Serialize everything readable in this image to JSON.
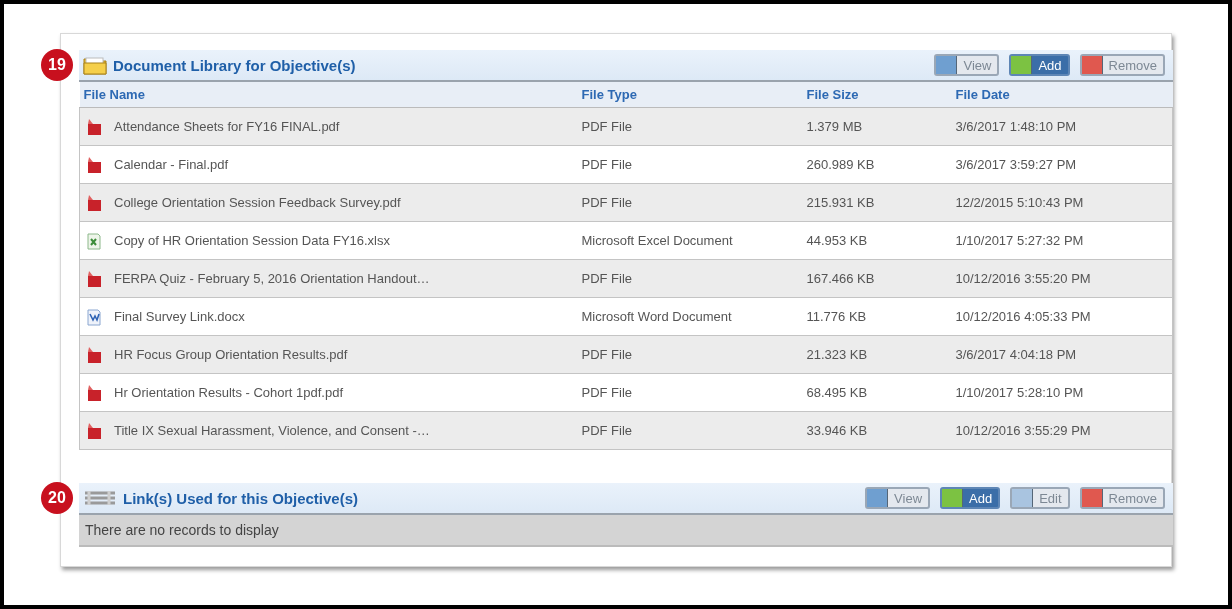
{
  "sections": [
    {
      "badge": "19",
      "kind": "documents",
      "title": "Document Library for Objective(s)",
      "buttons": [
        {
          "kind": "view",
          "label": "View",
          "disabled": true
        },
        {
          "kind": "add",
          "label": "Add",
          "disabled": false
        },
        {
          "kind": "remove",
          "label": "Remove",
          "disabled": true
        }
      ],
      "table": {
        "columns": [
          "File Name",
          "File Type",
          "File Size",
          "File Date"
        ],
        "rows": [
          {
            "kind": "pdf",
            "cells": [
              "Attendance Sheets for FY16 FINAL.pdf",
              "PDF File",
              "1.379 MB",
              "3/6/2017 1:48:10 PM"
            ]
          },
          {
            "kind": "pdf",
            "cells": [
              "Calendar - Final.pdf",
              "PDF File",
              "260.989 KB",
              "3/6/2017 3:59:27 PM"
            ]
          },
          {
            "kind": "pdf",
            "cells": [
              "College Orientation Session Feedback Survey.pdf",
              "PDF File",
              "215.931 KB",
              "12/2/2015 5:10:43 PM"
            ]
          },
          {
            "kind": "excel",
            "cells": [
              "Copy of HR Orientation Session Data FY16.xlsx",
              "Microsoft Excel Document",
              "44.953 KB",
              "1/10/2017 5:27:32 PM"
            ]
          },
          {
            "kind": "pdf",
            "cells": [
              "FERPA Quiz - February 5, 2016 Orientation Handout…",
              "PDF File",
              "167.466 KB",
              "10/12/2016 3:55:20 PM"
            ]
          },
          {
            "kind": "word",
            "cells": [
              "Final Survey Link.docx",
              "Microsoft Word Document",
              "11.776 KB",
              "10/12/2016 4:05:33 PM"
            ]
          },
          {
            "kind": "pdf",
            "cells": [
              "HR Focus Group Orientation Results.pdf",
              "PDF File",
              "21.323 KB",
              "3/6/2017 4:04:18 PM"
            ]
          },
          {
            "kind": "pdf",
            "cells": [
              "Hr Orientation Results - Cohort 1pdf.pdf",
              "PDF File",
              "68.495 KB",
              "1/10/2017 5:28:10 PM"
            ]
          },
          {
            "kind": "pdf",
            "cells": [
              "Title IX Sexual Harassment, Violence, and Consent -…",
              "PDF File",
              "33.946 KB",
              "10/12/2016 3:55:29 PM"
            ]
          }
        ]
      }
    },
    {
      "badge": "20",
      "kind": "links",
      "title": "Link(s) Used for this Objective(s)",
      "buttons": [
        {
          "kind": "view",
          "label": "View",
          "disabled": true
        },
        {
          "kind": "add",
          "label": "Add",
          "disabled": false
        },
        {
          "kind": "edit",
          "label": "Edit",
          "disabled": true
        },
        {
          "kind": "remove",
          "label": "Remove",
          "disabled": true
        }
      ],
      "empty": "There are no records to display"
    }
  ]
}
